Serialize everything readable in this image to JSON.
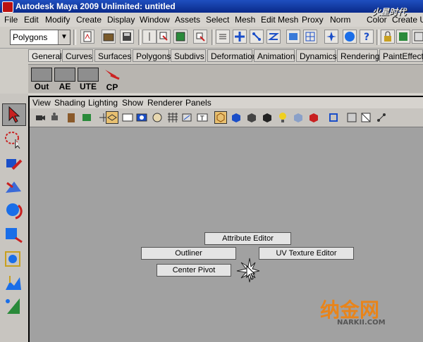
{
  "window": {
    "title": "Autodesk Maya 2009 Unlimited: untitled"
  },
  "menubar": [
    "File",
    "Edit",
    "Modify",
    "Create",
    "Display",
    "Window",
    "Assets",
    "Select",
    "Mesh",
    "Edit Mesh",
    "Proxy",
    "Norm",
    "Color",
    "Create UV"
  ],
  "toolbar": {
    "mode_select": "Polygons"
  },
  "shelf_tabs": [
    "General",
    "Curves",
    "Surfaces",
    "Polygons",
    "Subdivs",
    "Deformation",
    "Animation",
    "Dynamics",
    "Rendering",
    "PaintEffects"
  ],
  "shelf_buttons": [
    "Out",
    "AE",
    "UTE",
    "CP"
  ],
  "panel_menu": [
    "View",
    "Shading",
    "Lighting",
    "Show",
    "Renderer",
    "Panels"
  ],
  "hotbox": {
    "attribute_editor": "Attribute Editor",
    "outliner": "Outliner",
    "uv_texture_editor": "UV Texture Editor",
    "center_pivot": "Center Pivot"
  },
  "watermark": {
    "top": "火星时代",
    "bottom_cn": "纳金网",
    "bottom_url": "NARKII.COM"
  },
  "colors": {
    "title_bar": "#0a2a8a",
    "viewport": "#a1a1a1",
    "accent_red": "#cc2222"
  }
}
